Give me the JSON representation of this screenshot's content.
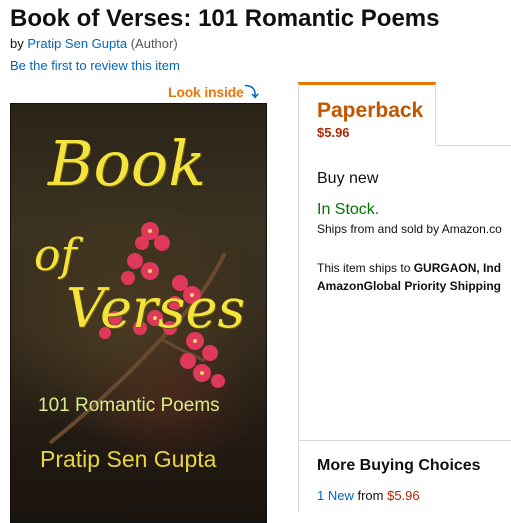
{
  "product": {
    "title": "Book of Verses: 101 Romantic Poems",
    "by": "by",
    "author": "Pratip Sen Gupta",
    "author_role": "(Author)",
    "review_link": "Be the first to review this item"
  },
  "look_inside": {
    "label": "Look inside",
    "arrow": "⤵"
  },
  "cover": {
    "title_line1": "Book",
    "title_line2": "of",
    "title_line3": "Verses",
    "subtitle": "101 Romantic Poems",
    "author": "Pratip Sen Gupta"
  },
  "format_tab": {
    "label": "Paperback",
    "price": "$5.96"
  },
  "buybox": {
    "buy_new": "Buy new",
    "stock": "In Stock.",
    "ships_from": "Ships from and sold by Amazon.co",
    "ships_to_prefix": "This item ships to ",
    "ships_to_place": "GURGAON, Ind",
    "shipping_method": "AmazonGlobal Priority Shipping"
  },
  "more_buying": {
    "title": "More Buying Choices",
    "count_link": "1 New",
    "from": "from",
    "price": "$5.96"
  },
  "colors": {
    "link": "#0066c0",
    "format_orange": "#c45500",
    "tab_accent": "#e77600",
    "price_red": "#b12704",
    "stock_green": "#007600",
    "look_inside_orange": "#e47911",
    "cover_title_yellow": "#f3e33a"
  }
}
